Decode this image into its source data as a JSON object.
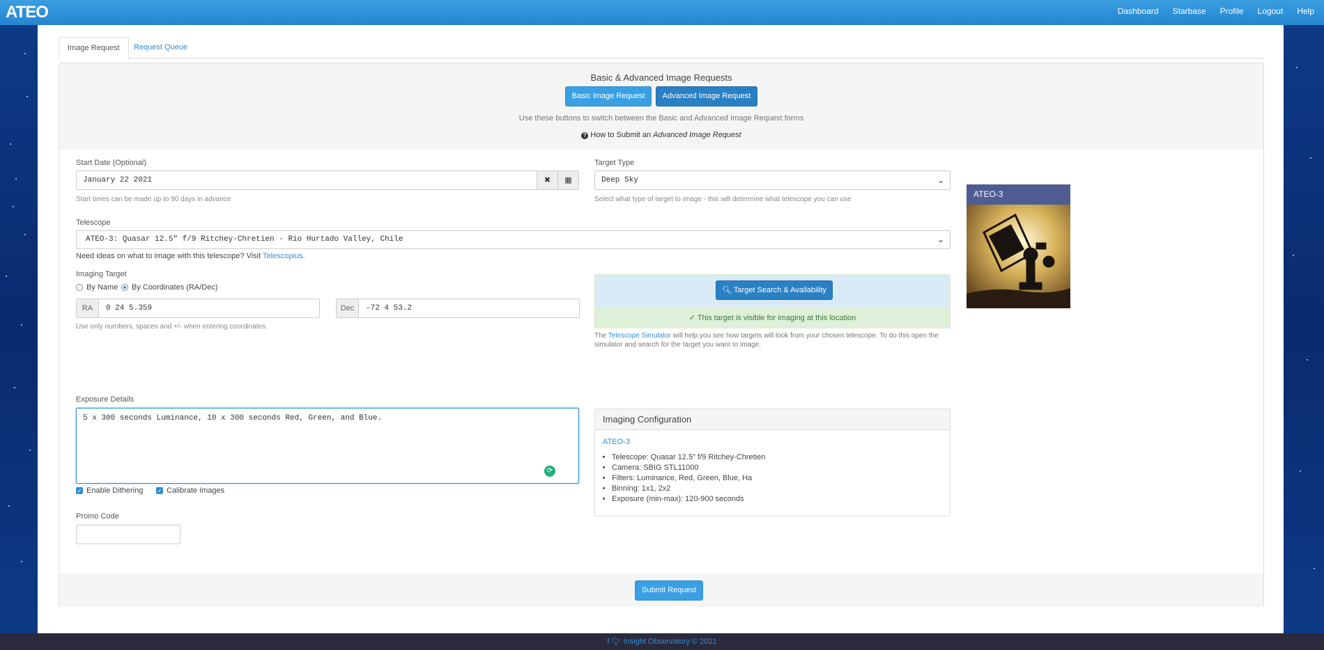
{
  "brand": "ATEO",
  "nav": {
    "dashboard": "Dashboard",
    "starbase": "Starbase",
    "profile": "Profile",
    "logout": "Logout",
    "help": "Help"
  },
  "tabs": {
    "image_request": "Image Request",
    "request_queue": "Request Queue"
  },
  "panel": {
    "title": "Basic & Advanced Image Requests",
    "basic_button": "Basic Image Request",
    "advanced_button": "Advanced Image Request",
    "switch_help": "Use these buttons to switch between the Basic and Advanced Image Request forms",
    "how_to_prefix": "How to Submit an",
    "how_to_em": "Advanced Image Request"
  },
  "start_date": {
    "label": "Start Date (Optional)",
    "value": "January 22 2021",
    "hint": "Start times can be made up to 90 days in advance"
  },
  "target_type": {
    "label": "Target Type",
    "value": "Deep Sky",
    "hint": "Select what type of target to image - this will determine what telescope you can use"
  },
  "telescope": {
    "label": "Telescope",
    "value": "ATEO-3: Quasar 12.5\" f/9 Ritchey-Chretien - Rio Hurtado Valley, Chile",
    "ideas_prefix": "Need ideas on what to image with this telescope? Visit",
    "ideas_link": "Telescopius",
    "ideas_suffix": "."
  },
  "imaging_target": {
    "label": "Imaging Target",
    "by_name": "By Name",
    "by_coords": "By Coordinates (RA/Dec)",
    "ra_label": "RA",
    "ra_value": "0 24 5.359",
    "dec_label": "Dec",
    "dec_value": "-72 4 53.2",
    "hint": "Use only numbers, spaces and +/- when entering coordinates."
  },
  "target_search": {
    "button": "Target Search & Availability",
    "visible_msg": "This target is visible for imaging at this location",
    "sim_prefix": "The",
    "sim_link": "Telescope Simulator",
    "sim_line1": "will help you see how targets will look from your chosen telescope. To do this open the",
    "sim_line2": "simulator and search for the target you want to image."
  },
  "exposure": {
    "label": "Exposure Details",
    "value": "5 x 300 seconds Luminance, 10 x 300 seconds Red, Green, and Blue."
  },
  "config": {
    "title": "Imaging Configuration",
    "name": "ATEO-3",
    "items": [
      "Telescope: Quasar 12.5\" f/9 Ritchey-Chretien",
      "Camera: SBIG STL11000",
      "Filters: Luminance, Red, Green, Blue, Ha",
      "Binning: 1x1, 2x2",
      "Exposure (min-max): 120-900 seconds"
    ]
  },
  "telescope_card": {
    "name": "ATEO-3"
  },
  "options": {
    "dithering": "Enable Dithering",
    "calibrate": "Calibrate Images"
  },
  "promo": {
    "label": "Promo Code",
    "value": ""
  },
  "submit": "Submit Request",
  "footer": {
    "text": "Insight Observatory © 2021"
  },
  "colors": {
    "navbar": "#2f8ed5",
    "primary": "#3aa0e3",
    "success_bg": "#dff0d8",
    "info_bg": "#d9eaf7",
    "card_head": "#4f5b93",
    "footer_bg": "#2a2a3c"
  }
}
